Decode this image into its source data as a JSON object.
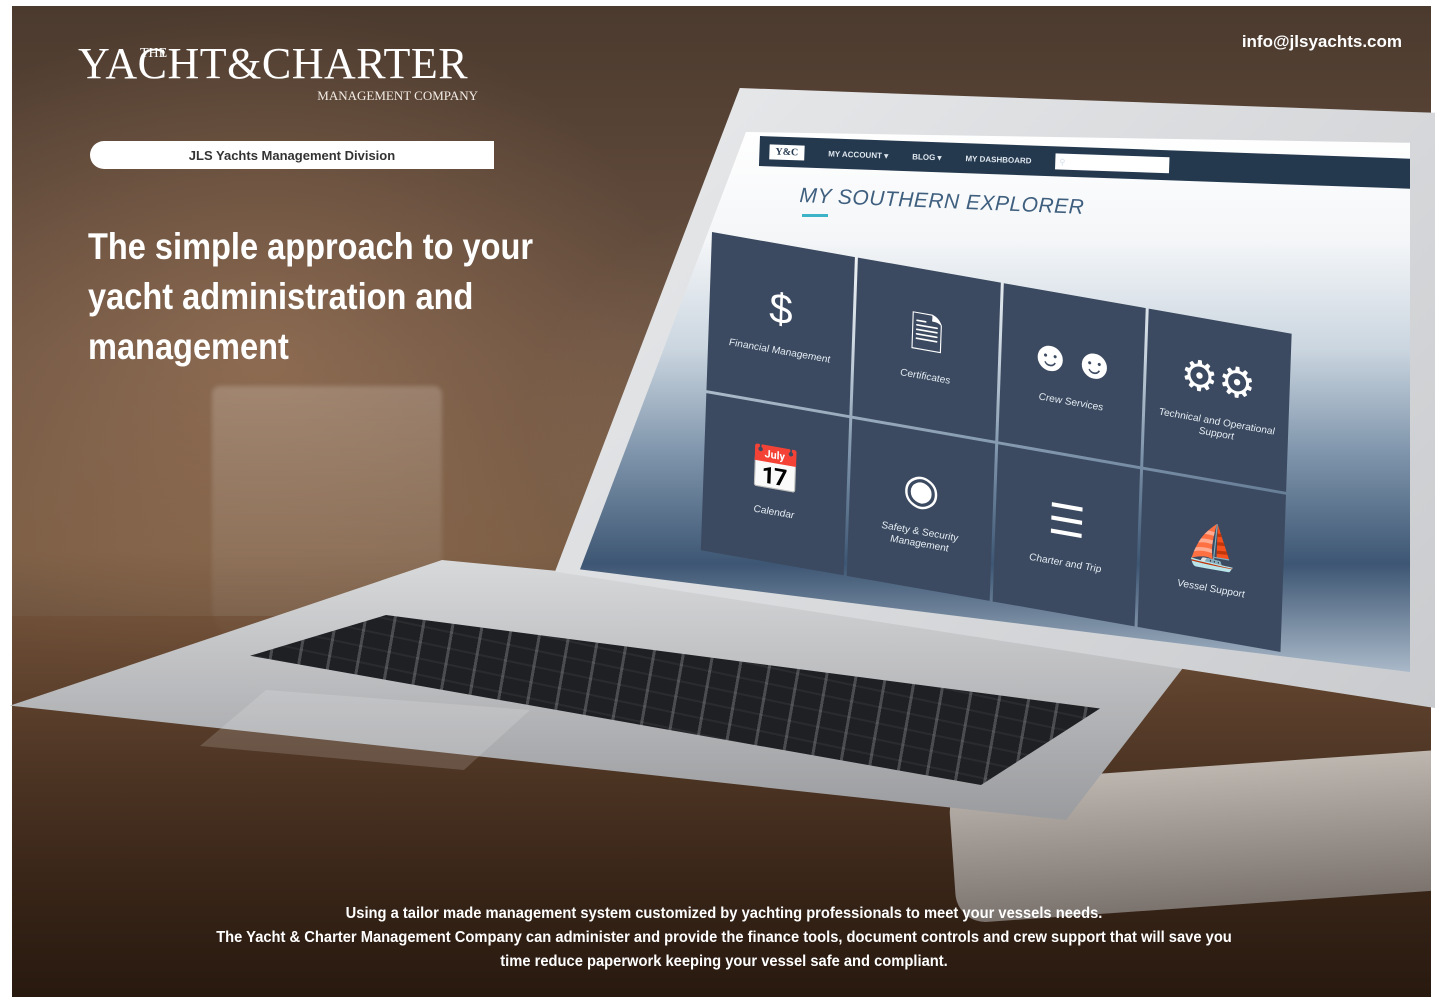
{
  "header": {
    "email": "info@jlsyachts.com"
  },
  "logo": {
    "the": "THE",
    "main": "YACHT&CHARTER",
    "sub": "MANAGEMENT COMPANY",
    "division": "JLS Yachts Management Division"
  },
  "headline": "The simple approach to your yacht administration and management",
  "screen": {
    "nav": {
      "my_account": "MY ACCOUNT ▾",
      "blog": "BLOG ▾",
      "my_dashboard": "MY DASHBOARD"
    },
    "title": "MY SOUTHERN EXPLORER",
    "tiles": [
      {
        "label": "Financial Management",
        "icon": "money-hands-icon"
      },
      {
        "label": "Certificates",
        "icon": "certificate-icon"
      },
      {
        "label": "Crew Services",
        "icon": "crew-icon"
      },
      {
        "label": "Technical and Operational Support",
        "icon": "gears-icon"
      },
      {
        "label": "Calendar",
        "icon": "calendar-icon"
      },
      {
        "label": "Safety & Security Management",
        "icon": "lifebuoy-icon"
      },
      {
        "label": "Charter and Trip",
        "icon": "checklist-icon"
      },
      {
        "label": "Vessel Support",
        "icon": "yacht-icon"
      }
    ]
  },
  "footer": {
    "line1": "Using a tailor made management system customized by yachting professionals to meet your vessels needs.",
    "line2": "The Yacht & Charter Management Company can administer and provide the finance tools, document controls and crew support that will save you",
    "line3": "time reduce paperwork keeping your vessel safe and compliant."
  }
}
